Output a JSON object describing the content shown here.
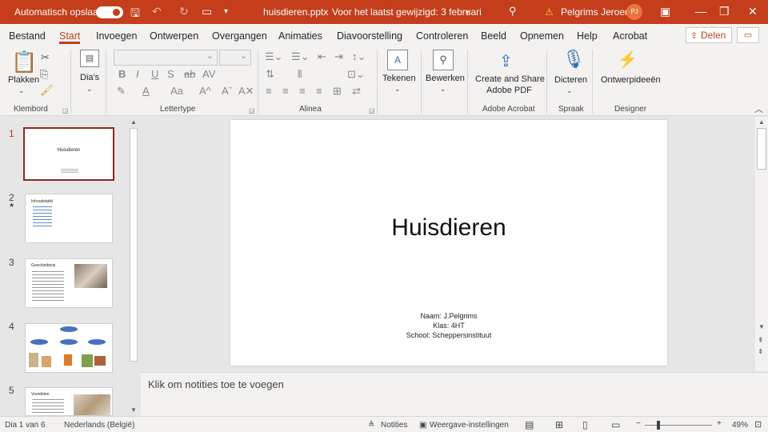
{
  "titlebar": {
    "autosave_label": "Automatisch opslaan",
    "filename": "huisdieren.pptx",
    "separator": "-",
    "modified": "Voor het laatst gewijzigd: 3 februari",
    "warning_icon": "⚠",
    "user_name": "Pelgrims Jeroen",
    "user_initials": "PJ"
  },
  "tabs": [
    "Bestand",
    "Start",
    "Invoegen",
    "Ontwerpen",
    "Overgangen",
    "Animaties",
    "Diavoorstelling",
    "Controleren",
    "Beeld",
    "Opnemen",
    "Help",
    "Acrobat"
  ],
  "share_label": "Delen",
  "ribbon": {
    "paste_label": "Plakken",
    "clipboard_group": "Klembord",
    "slides_label": "Dia's",
    "font_group": "Lettertype",
    "paragraph_group": "Alinea",
    "drawing_label": "Tekenen",
    "editing_label": "Bewerken",
    "acrobat_button": "Create and Share",
    "acrobat_button2": "Adobe PDF",
    "acrobat_group": "Adobe Acrobat",
    "dictate_label": "Dicteren",
    "voice_group": "Spraak",
    "designer_label": "Ontwerpideeën",
    "designer_group": "Designer"
  },
  "thumbnails": [
    {
      "num": "1",
      "title": "Huisdieren"
    },
    {
      "num": "2",
      "title": "Inhoudstafel",
      "items": [
        "Geschiedenis",
        "Soorten",
        "Honden",
        "Katten",
        "Vissen",
        "Voordelen",
        "Dierenwelzijn"
      ]
    },
    {
      "num": "3",
      "title": "Geschiedenis"
    },
    {
      "num": "4",
      "title": ""
    },
    {
      "num": "5",
      "title": "Voordelen"
    }
  ],
  "slide": {
    "title": "Huisdieren",
    "name": "Naam: J.Pelgrims",
    "class": "Klas: 4HT",
    "school": "School: Scheppersinstituut"
  },
  "notes_placeholder": "Klik om notities toe te voegen",
  "status": {
    "slide_info": "Dia 1 van 6",
    "language": "Nederlands (België)",
    "notes": "Notities",
    "view_settings": "Weergave-instellingen",
    "zoom": "49%"
  },
  "colors": {
    "accent": "#c43e1c",
    "slide_border": "#8a2a1c"
  }
}
